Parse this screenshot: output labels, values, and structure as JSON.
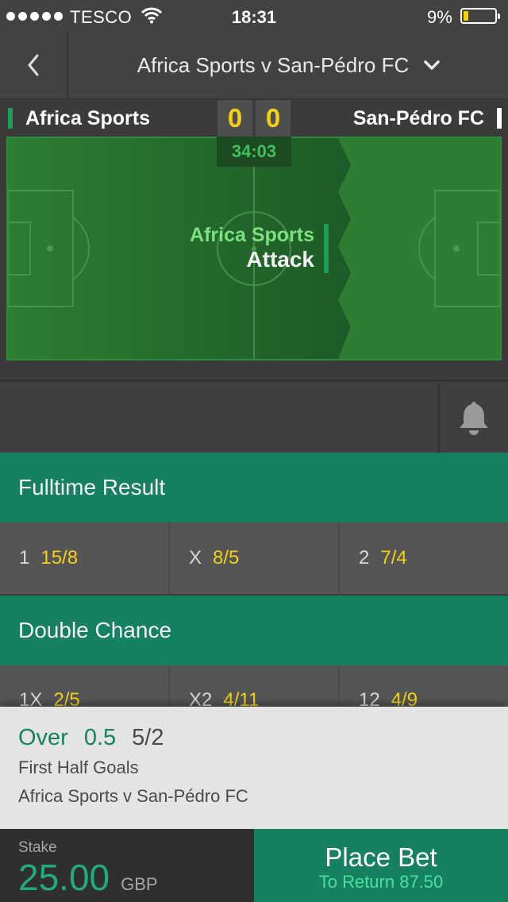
{
  "status_bar": {
    "carrier": "TESCO",
    "time": "18:31",
    "battery_pct": "9%",
    "battery_level": 0.09
  },
  "nav": {
    "title": "Africa Sports v San-Pédro FC"
  },
  "match": {
    "home_team": "Africa Sports",
    "away_team": "San-Pédro FC",
    "home_score": "0",
    "away_score": "0",
    "clock": "34:03",
    "attack_team": "Africa Sports",
    "attack_label": "Attack"
  },
  "markets": [
    {
      "name": "Fulltime Result",
      "selections": [
        {
          "sel": "1",
          "price": "15/8"
        },
        {
          "sel": "X",
          "price": "8/5"
        },
        {
          "sel": "2",
          "price": "7/4"
        }
      ]
    },
    {
      "name": "Double Chance",
      "selections": [
        {
          "sel": "1X",
          "price": "2/5"
        },
        {
          "sel": "X2",
          "price": "4/11"
        },
        {
          "sel": "12",
          "price": "4/9"
        }
      ]
    }
  ],
  "betslip": {
    "selection": "Over",
    "handicap": "0.5",
    "price": "5/2",
    "market": "First Half Goals",
    "event": "Africa Sports v San-Pédro FC",
    "stake_label": "Stake",
    "stake_value": "25.00",
    "currency": "GBP",
    "place_label": "Place Bet",
    "to_return": "To Return 87.50"
  },
  "colors": {
    "accent_green": "#168160",
    "price_yellow": "#f5d015",
    "pitch_green": "#2e7d32"
  }
}
